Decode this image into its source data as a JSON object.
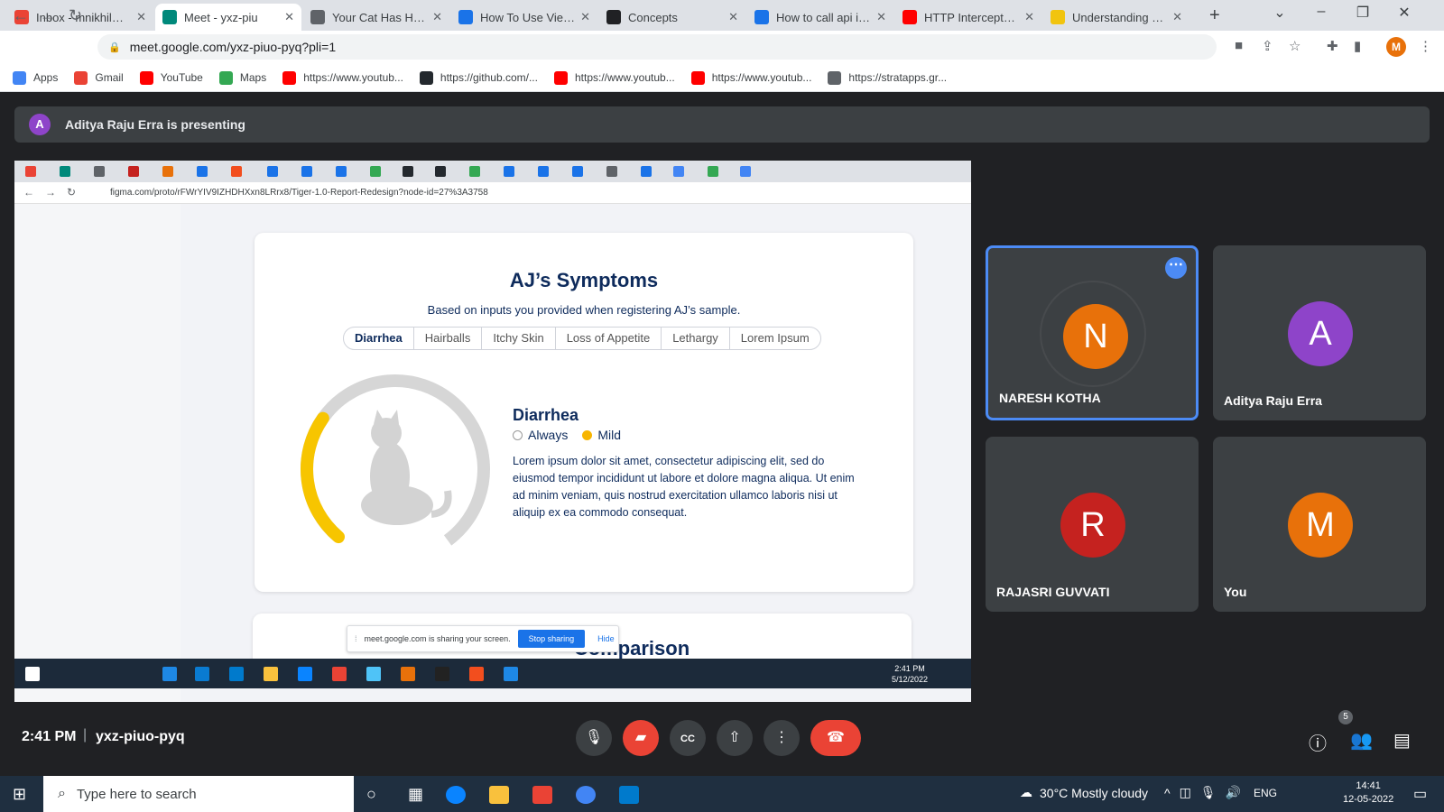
{
  "browser": {
    "tabs": [
      {
        "title": "Inbox - mnikhil@st",
        "icon": "gmail-icon",
        "color": "#ea4335"
      },
      {
        "title": "Meet - yxz-piu",
        "icon": "meet-icon",
        "color": "#00897b",
        "active": true
      },
      {
        "title": "Your Cat Has Hairb",
        "icon": "globe-icon",
        "color": "#5f6368"
      },
      {
        "title": "How To Use ViewC",
        "icon": "react-icon",
        "color": "#1a73e8"
      },
      {
        "title": "Concepts",
        "icon": "angular-icon",
        "color": "#202124"
      },
      {
        "title": "How to call api in a",
        "icon": "react-native-icon",
        "color": "#1a73e8"
      },
      {
        "title": "HTTP Interceptors",
        "icon": "youtube-icon",
        "color": "#ff0000"
      },
      {
        "title": "Understanding HT",
        "icon": "tek-icon",
        "color": "#f1c40f"
      }
    ],
    "url": "meet.google.com/yxz-piuo-pyq?pli=1",
    "bookmarks": [
      {
        "label": "Apps",
        "color": "#4285f4"
      },
      {
        "label": "Gmail",
        "color": "#ea4335"
      },
      {
        "label": "YouTube",
        "color": "#ff0000"
      },
      {
        "label": "Maps",
        "color": "#34a853"
      },
      {
        "label": "https://www.youtub...",
        "color": "#ff0000"
      },
      {
        "label": "https://github.com/...",
        "color": "#24292e"
      },
      {
        "label": "https://www.youtub...",
        "color": "#ff0000"
      },
      {
        "label": "https://www.youtub...",
        "color": "#ff0000"
      },
      {
        "label": "https://stratapps.gr...",
        "color": "#5f6368"
      }
    ],
    "profile_initial": "M"
  },
  "meet": {
    "presenting_initial": "A",
    "presenting_text": "Aditya Raju Erra is presenting",
    "time": "2:41 PM",
    "separator": "|",
    "code": "yxz-piuo-pyq",
    "participant_count": "5",
    "participants": [
      {
        "initial": "N",
        "name": "NARESH KOTHA",
        "color": "#e8710a"
      },
      {
        "initial": "A",
        "name": "Aditya Raju Erra",
        "color": "#8e44c9"
      },
      {
        "initial": "R",
        "name": "RAJASRI GUVVATI",
        "color": "#c5221f"
      },
      {
        "initial": "M",
        "name": "You",
        "color": "#e8710a"
      }
    ]
  },
  "shared": {
    "url": "figma.com/proto/rFWrYIV9IZHDHXxn8LRrx8/Tiger-1.0-Report-Redesign?node-id=27%3A3758",
    "card_title": "AJ’s Symptoms",
    "card_subtitle": "Based on inputs you provided when registering AJ’s sample.",
    "symptom_tabs": [
      "Diarrhea",
      "Hairballs",
      "Itchy Skin",
      "Loss of Appetite",
      "Lethargy",
      "Lorem Ipsum"
    ],
    "detail_title": "Diarrhea",
    "frequency": "Always",
    "severity": "Mild",
    "body": "Lorem ipsum dolor sit amet, consectetur adipiscing elit, sed do eiusmod tempor incididunt ut labore et dolore magna aliqua. Ut enim ad minim veniam, quis nostrud exercitation ullamco laboris nisi ut aliquip ex ea commodo consequat.",
    "gauge_level": 0.3,
    "next_title": "Comparison",
    "share_notice": "meet.google.com is sharing your screen.",
    "stop_label": "Stop sharing",
    "hide_label": "Hide",
    "taskbar_time": "2:41 PM",
    "taskbar_date": "5/12/2022"
  },
  "taskbar": {
    "search_placeholder": "Type here to search",
    "weather": "30°C  Mostly cloudy",
    "lang": "ENG",
    "time": "14:41",
    "date": "12-05-2022"
  }
}
